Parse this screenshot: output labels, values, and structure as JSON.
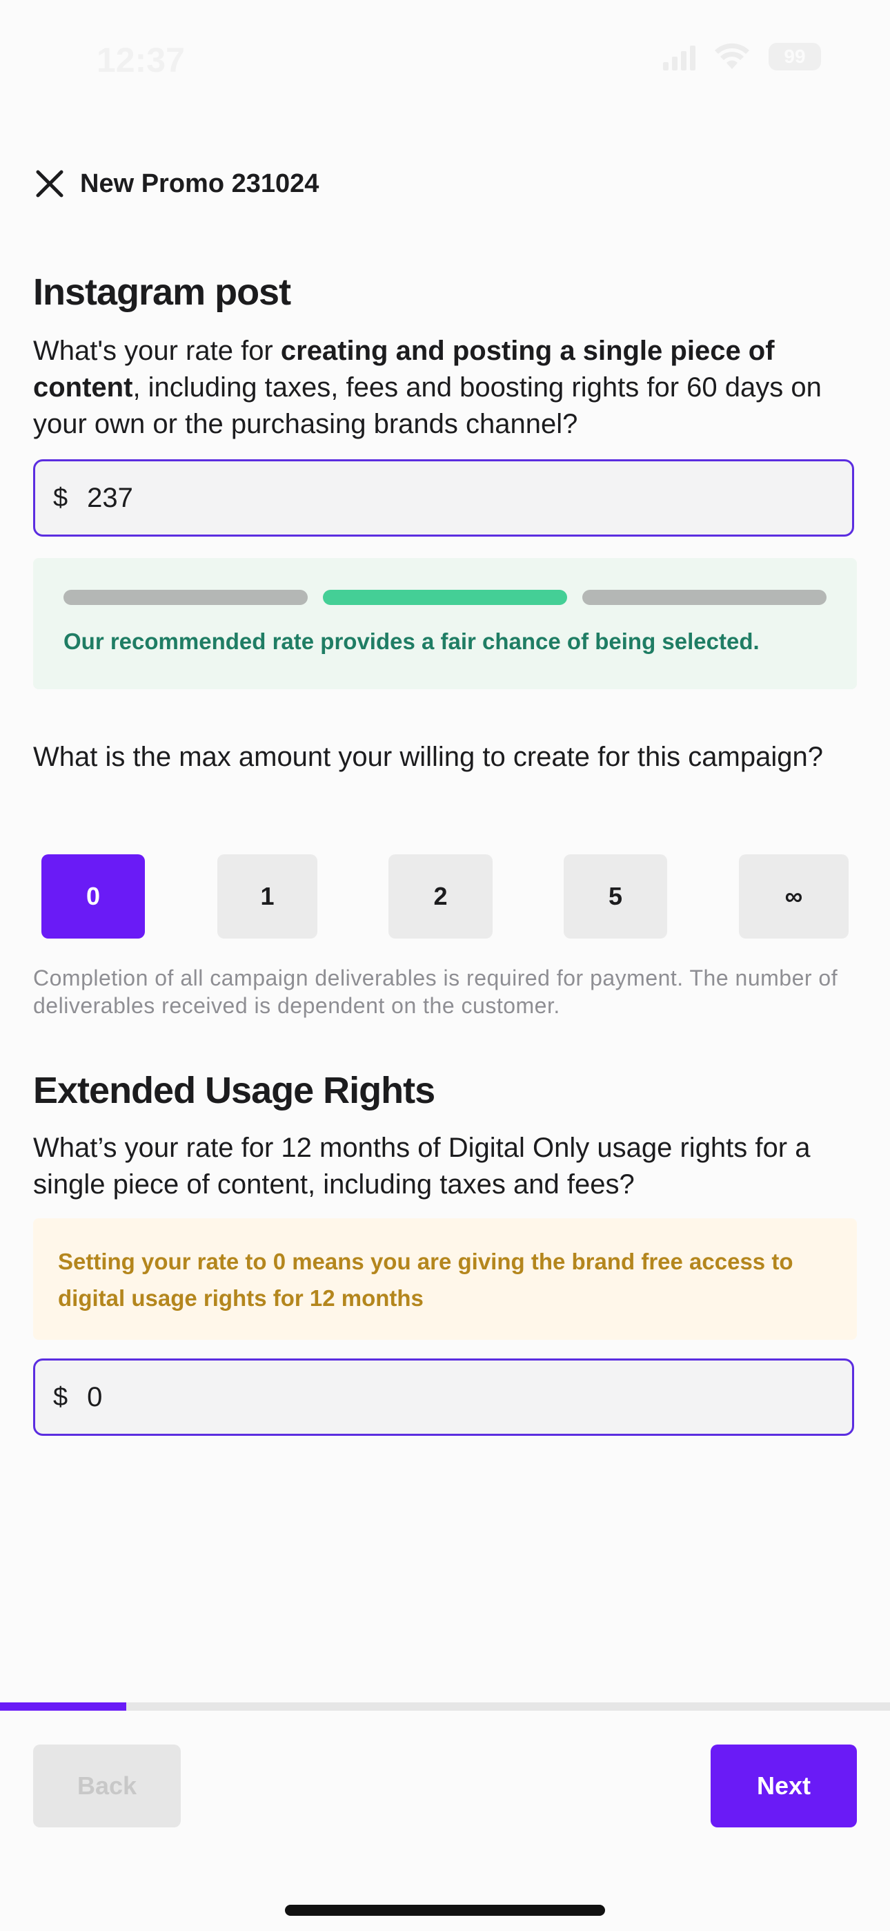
{
  "status_bar": {
    "time": "12:37",
    "battery": "99"
  },
  "header": {
    "title": "New Promo 231024"
  },
  "instagram": {
    "title": "Instagram post",
    "question_pre": "What's your rate for ",
    "question_bold": "creating and posting a single piece of content",
    "question_post": ", including taxes, fees and boosting rights for 60 days on your own or the purchasing brands channel?",
    "currency": "$",
    "rate_value": "237",
    "meter_active_index": 1,
    "recommendation": "Our recommended rate provides a fair chance of being selected."
  },
  "max_amount": {
    "question": "What is the max amount your willing to create for this campaign?",
    "options": [
      "0",
      "1",
      "2",
      "5",
      "∞"
    ],
    "selected": "0",
    "disclaimer": "Completion of all campaign deliverables is required for payment. The number of deliverables received is dependent on the customer."
  },
  "usage_rights": {
    "title": "Extended Usage Rights",
    "question": "What’s your rate for 12 months of Digital Only usage rights for a single piece of content, including taxes and fees?",
    "notice": "Setting your rate to 0 means you are giving the brand free access to digital usage rights for 12 months",
    "currency": "$",
    "rate_value": "0"
  },
  "progress": {
    "fraction": 0.142
  },
  "footer": {
    "back_label": "Back",
    "next_label": "Next"
  },
  "colors": {
    "accent": "#6a1bf6",
    "success": "#44cf96",
    "warning_text": "#b4861d"
  }
}
